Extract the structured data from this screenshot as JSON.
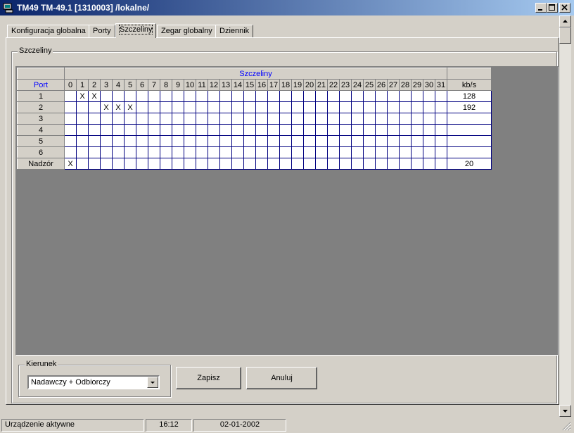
{
  "window": {
    "title": "TM49 TM-49.1 [1310003] /lokalne/"
  },
  "tabs": [
    {
      "label": "Konfiguracja globalna"
    },
    {
      "label": "Porty"
    },
    {
      "label": "Szczeliny",
      "active": true
    },
    {
      "label": "Zegar globalny"
    },
    {
      "label": "Dziennik"
    }
  ],
  "group_title": "Szczeliny",
  "grid": {
    "group_header": "Szczeliny",
    "port_header": "Port",
    "rate_header": "kb/s",
    "slots": [
      "0",
      "1",
      "2",
      "3",
      "4",
      "5",
      "6",
      "7",
      "8",
      "9",
      "10",
      "11",
      "12",
      "13",
      "14",
      "15",
      "16",
      "17",
      "18",
      "19",
      "20",
      "21",
      "22",
      "23",
      "24",
      "25",
      "26",
      "27",
      "28",
      "29",
      "30",
      "31"
    ],
    "mark": "X",
    "rows": [
      {
        "label": "1",
        "marked": [
          1,
          2
        ],
        "rate": "128"
      },
      {
        "label": "2",
        "marked": [
          3,
          4,
          5
        ],
        "rate": "192"
      },
      {
        "label": "3",
        "marked": [],
        "rate": ""
      },
      {
        "label": "4",
        "marked": [],
        "rate": ""
      },
      {
        "label": "5",
        "marked": [],
        "rate": ""
      },
      {
        "label": "6",
        "marked": [],
        "rate": ""
      },
      {
        "label": "Nadzór",
        "marked": [
          0
        ],
        "rate": "20"
      }
    ]
  },
  "kierunek": {
    "label": "Kierunek",
    "selected": "Nadawczy + Odbiorczy"
  },
  "buttons": {
    "save": "Zapisz",
    "cancel": "Anuluj"
  },
  "status": {
    "state": "Urządzenie aktywne",
    "time": "16:12",
    "date": "02-01-2002"
  },
  "icons": [
    "app-icon",
    "minimize-icon",
    "maximize-icon",
    "close-icon",
    "scroll-up-icon",
    "scroll-down-icon",
    "dropdown-arrow-icon",
    "size-grip-icon"
  ]
}
